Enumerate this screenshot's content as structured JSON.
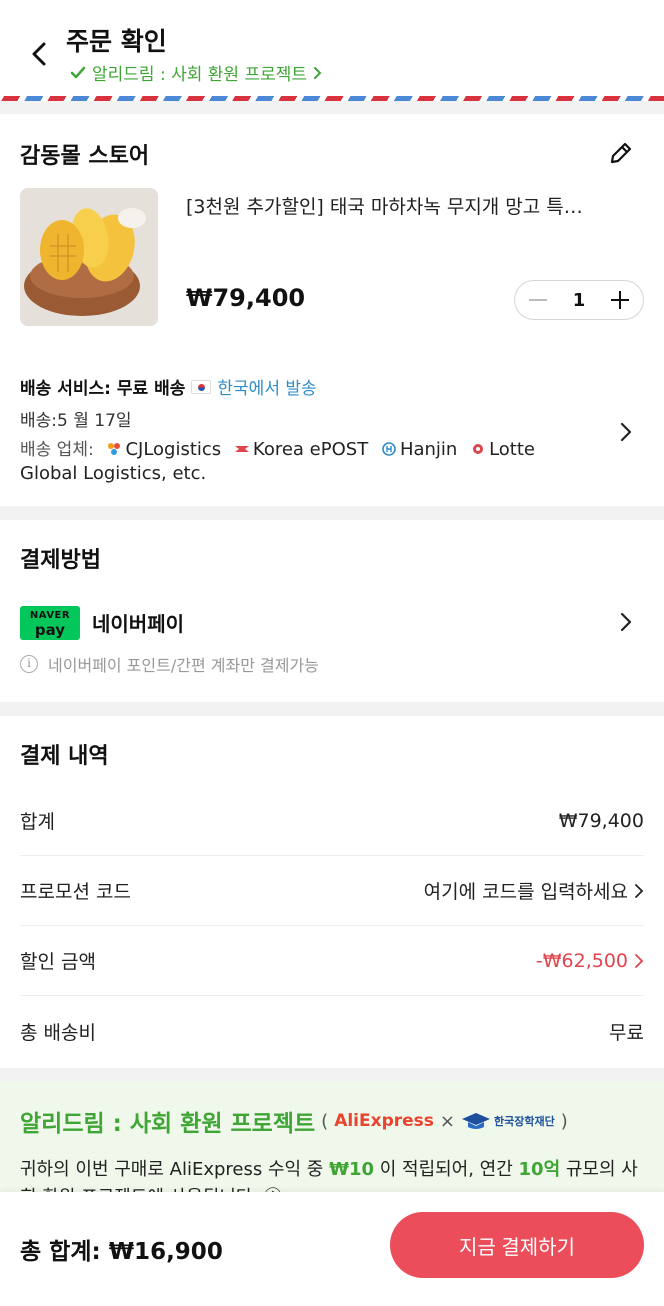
{
  "header": {
    "title": "주문 확인",
    "subtitle_link": "알리드림 : 사회 환원 프로젝트"
  },
  "store": {
    "name": "감동몰 스토어",
    "product_title": "[3천원 추가할인] 태국 마하차녹 무지개 망고 특…",
    "price": "₩79,400",
    "quantity": "1"
  },
  "shipping": {
    "service_label": "배송 서비스:",
    "service_value": "무료 배송",
    "origin": "한국에서 발송",
    "date": "배송:5 월 17일",
    "carriers_label": "배송 업체:",
    "carriers": [
      "CJLogistics",
      "Korea ePOST",
      "Hanjin",
      "Lotte"
    ],
    "carriers_suffix": "Global Logistics, etc."
  },
  "payment": {
    "section_title": "결제방법",
    "logo_top": "NAVER",
    "logo_bottom": "pay",
    "method_name": "네이버페이",
    "note": "네이버페이 포인트/간편 계좌만 결제가능"
  },
  "summary": {
    "section_title": "결제 내역",
    "rows": [
      {
        "label": "합계",
        "value": "₩79,400"
      },
      {
        "label": "프로모션 코드",
        "value": "여기에 코드를 입력하세요"
      },
      {
        "label": "할인 금액",
        "value": "-₩62,500"
      },
      {
        "label": "총 배송비",
        "value": "무료"
      }
    ]
  },
  "promo": {
    "title": "알리드림 : 사회 환원 프로젝트",
    "partner_open": "(",
    "partner1": "AliExpress",
    "times": "×",
    "partner2": "한국장학재단",
    "partner_close": ")",
    "text_pre": "귀하의 이번 구매로 AliExpress 수익 중 ",
    "amount": "₩10",
    "text_mid": " 이 적립되어, 연간 ",
    "scale": "10억",
    "text_post": " 규모의 사회 환원 프로젝트에 사용됩니다. ⓘ"
  },
  "footer": {
    "total": "총 합계: ₩16,900",
    "checkout_label": "지금 결제하기"
  },
  "colors": {
    "accent_green": "#3fa535",
    "checkout_red": "#eb4d5a",
    "discount_red": "#e0454f",
    "link_blue": "#2f8cc8"
  }
}
